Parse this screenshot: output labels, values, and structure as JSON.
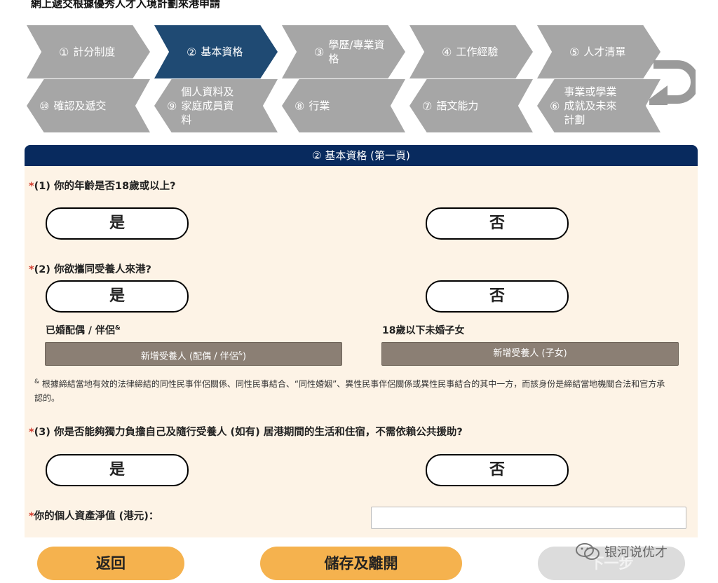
{
  "page_title": "網上遞交根據優秀人才入境計劃來港申請",
  "steps": [
    {
      "num": "①",
      "label": "計分制度"
    },
    {
      "num": "②",
      "label": "基本資格"
    },
    {
      "num": "③",
      "label": "學歷/專業資格"
    },
    {
      "num": "④",
      "label": "工作經驗"
    },
    {
      "num": "⑤",
      "label": "人才清單"
    },
    {
      "num": "⑩",
      "label": "確認及遞交"
    },
    {
      "num": "⑨",
      "label": "個人資料及家庭成員資料"
    },
    {
      "num": "⑧",
      "label": "行業"
    },
    {
      "num": "⑦",
      "label": "語文能力"
    },
    {
      "num": "⑥",
      "label": "事業或學業成就及未來計劃"
    }
  ],
  "colors": {
    "step_inactive": "#a6a6a6",
    "step_active": "#1f4a73",
    "panel_header": "#082a5e",
    "panel_bg": "#fdf3e6",
    "required": "#d23c2e",
    "orange_button": "#f5b24e",
    "add_button": "#8b7f74"
  },
  "panel": {
    "header": "② 基本資格 (第一頁)",
    "required_mark": "*",
    "q1": "(1) 你的年齡是否18歲或以上?",
    "q2": "(2) 你欲攜同受養人來港?",
    "q3": "(3) 你是否能夠獨力負擔自己及隨行受養人 (如有) 居港期間的生活和住宿，不需依賴公共援助?",
    "yes": "是",
    "no": "否",
    "spouse_label": "已婚配偶 / 伴侶",
    "spouse_sup": "&",
    "children_label": "18歲以下未婚子女",
    "add_spouse": "新增受養人 (配偶 / 伴侶",
    "add_spouse_sup": "&",
    "add_spouse_end": ")",
    "add_child": "新增受養人 (子女)",
    "note_sup": "&",
    "note": "根據締結當地有效的法律締結的同性民事伴侶關係、同性民事結合、“同性婚姻”、異性民事伴侶關係或異性民事結合的其中一方，而該身份是締結當地機關合法和官方承認的。",
    "net_worth_label": "你的個人資產淨值 (港元)：",
    "net_worth_value": ""
  },
  "buttons": {
    "back": "返回",
    "save_exit": "儲存及離開",
    "next": "下一步"
  },
  "watermark": "银河说优才"
}
